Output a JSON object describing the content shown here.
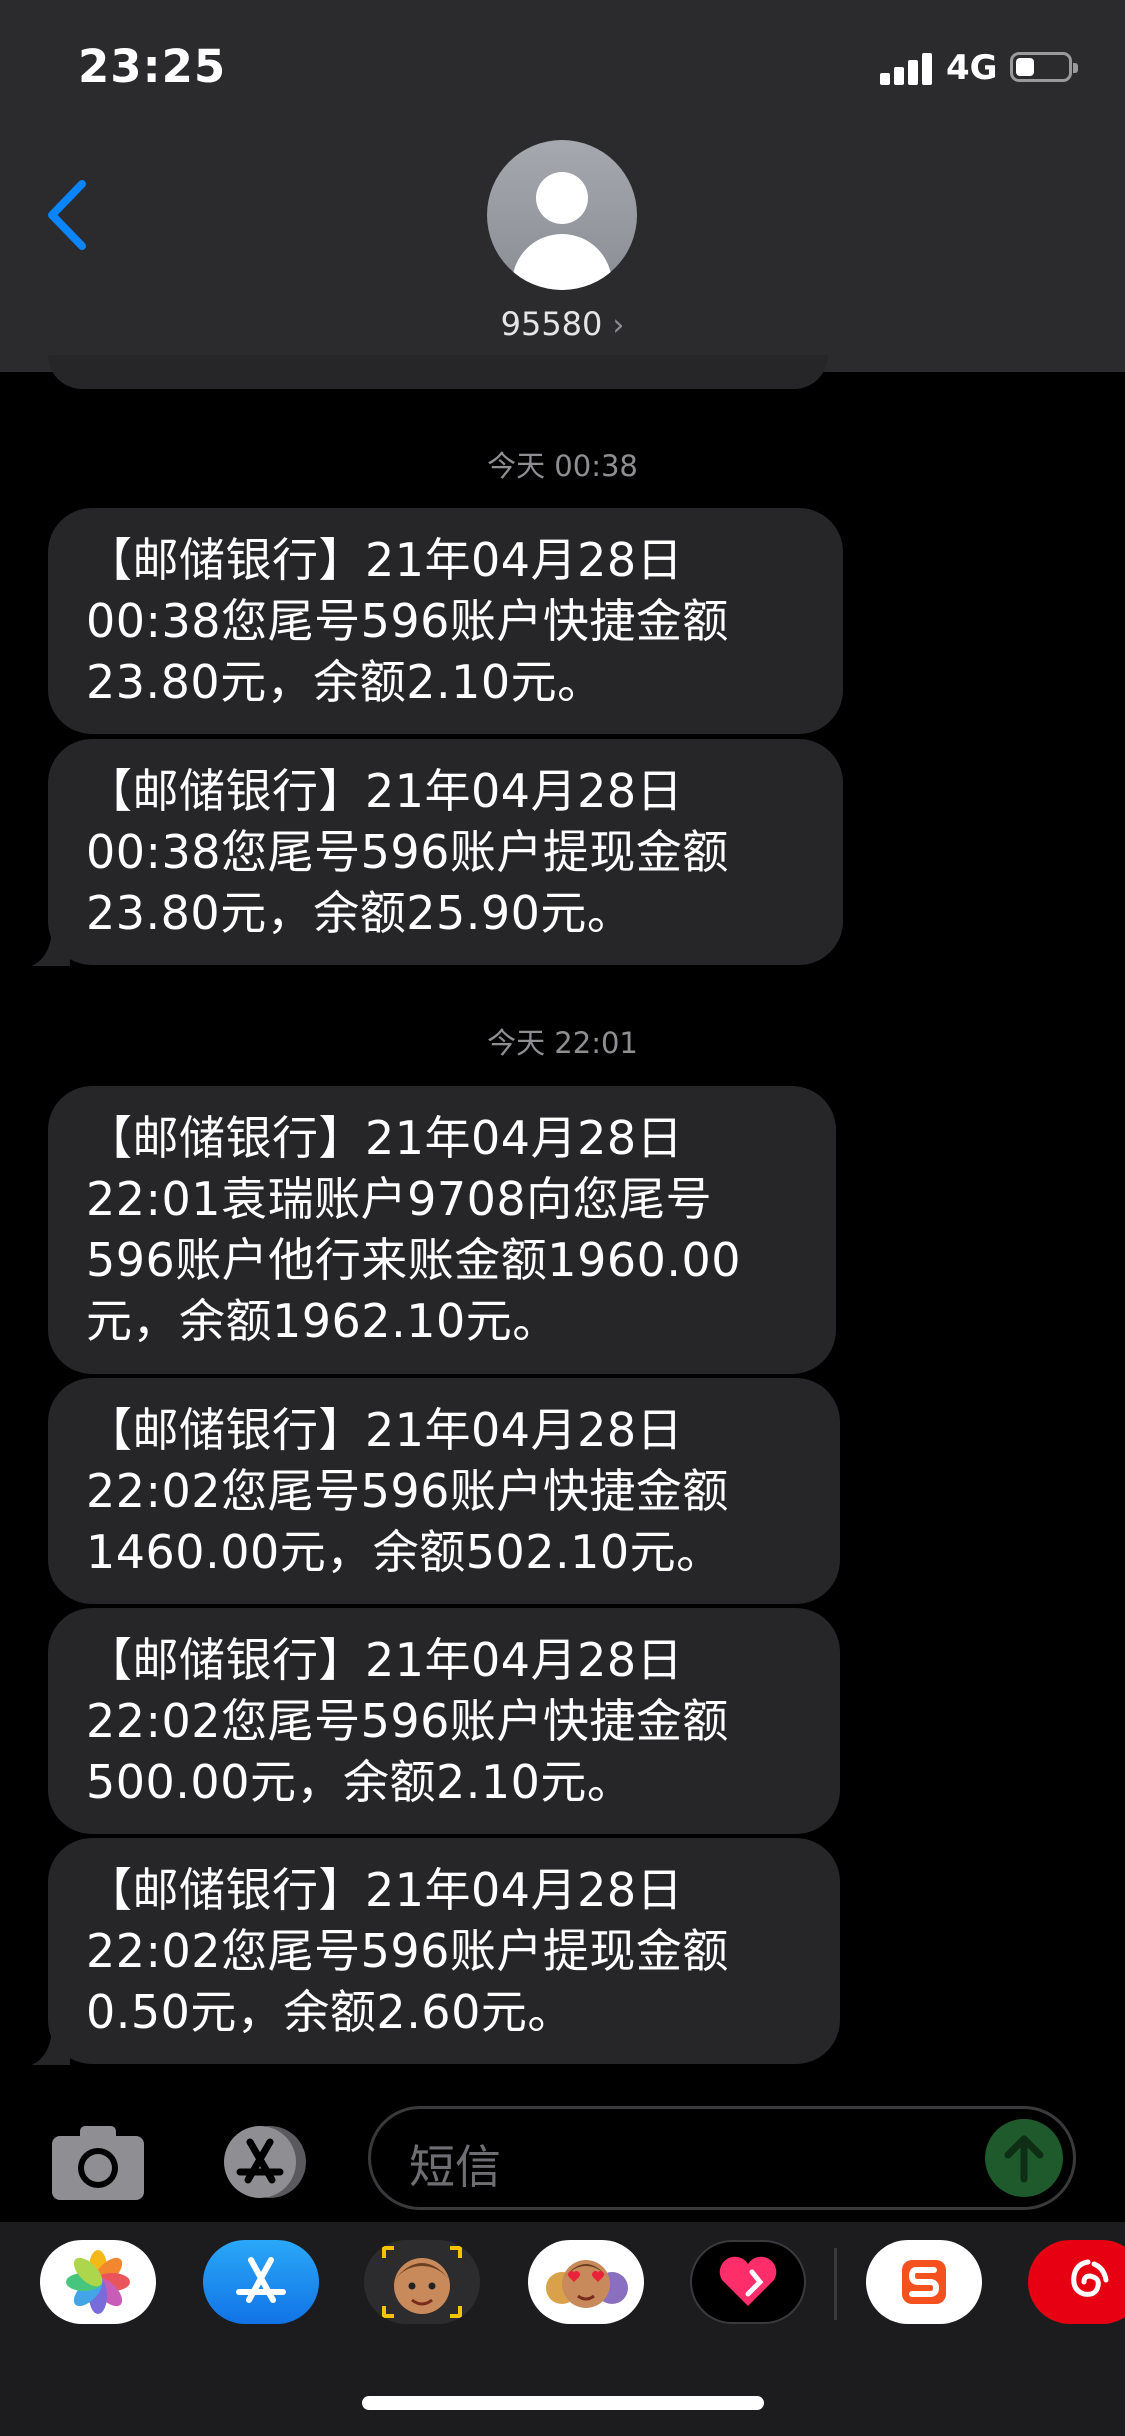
{
  "status_bar": {
    "time": "23:25",
    "network": "4G",
    "battery_level": 0.35
  },
  "contact": {
    "name": "95580",
    "chevron": "›"
  },
  "icons": {
    "back": "chevron-left-icon",
    "avatar": "person-icon",
    "camera": "camera-icon",
    "app_store": "app-store-icon",
    "send": "arrow-up-icon"
  },
  "colors": {
    "accent": "#0a84ff",
    "bubble": "#262628",
    "header": "#2b2b2d",
    "timestamp": "#8e8e93"
  },
  "timestamps": [
    "今天 00:38",
    "今天 22:01"
  ],
  "messages": [
    {
      "lines": [
        "【邮储银行】21年04月28日",
        "00:38您尾号596账户快捷金额",
        "23.80元，余额2.10元。"
      ]
    },
    {
      "lines": [
        "【邮储银行】21年04月28日",
        "00:38您尾号596账户提现金额",
        "23.80元，余额25.90元。"
      ]
    },
    {
      "lines": [
        "【邮储银行】21年04月28日",
        "22:01袁瑞账户9708向您尾号",
        "596账户他行来账金额1960.00",
        "元，余额1962.10元。"
      ]
    },
    {
      "lines": [
        "【邮储银行】21年04月28日",
        "22:02您尾号596账户快捷金额",
        "1460.00元，余额502.10元。"
      ]
    },
    {
      "lines": [
        "【邮储银行】21年04月28日",
        "22:02您尾号596账户快捷金额",
        "500.00元，余额2.10元。"
      ]
    },
    {
      "lines": [
        "【邮储银行】21年04月28日",
        "22:02您尾号596账户提现金额",
        "0.50元，余额2.60元。"
      ]
    }
  ],
  "input": {
    "placeholder": "短信"
  },
  "app_drawer": [
    {
      "icon": "photos-icon"
    },
    {
      "icon": "app-store-icon"
    },
    {
      "icon": "memoji-icon"
    },
    {
      "icon": "memoji-stickers-icon"
    },
    {
      "icon": "digital-touch-icon"
    },
    {
      "icon": "sogou-input-icon"
    },
    {
      "icon": "netease-music-icon"
    }
  ]
}
